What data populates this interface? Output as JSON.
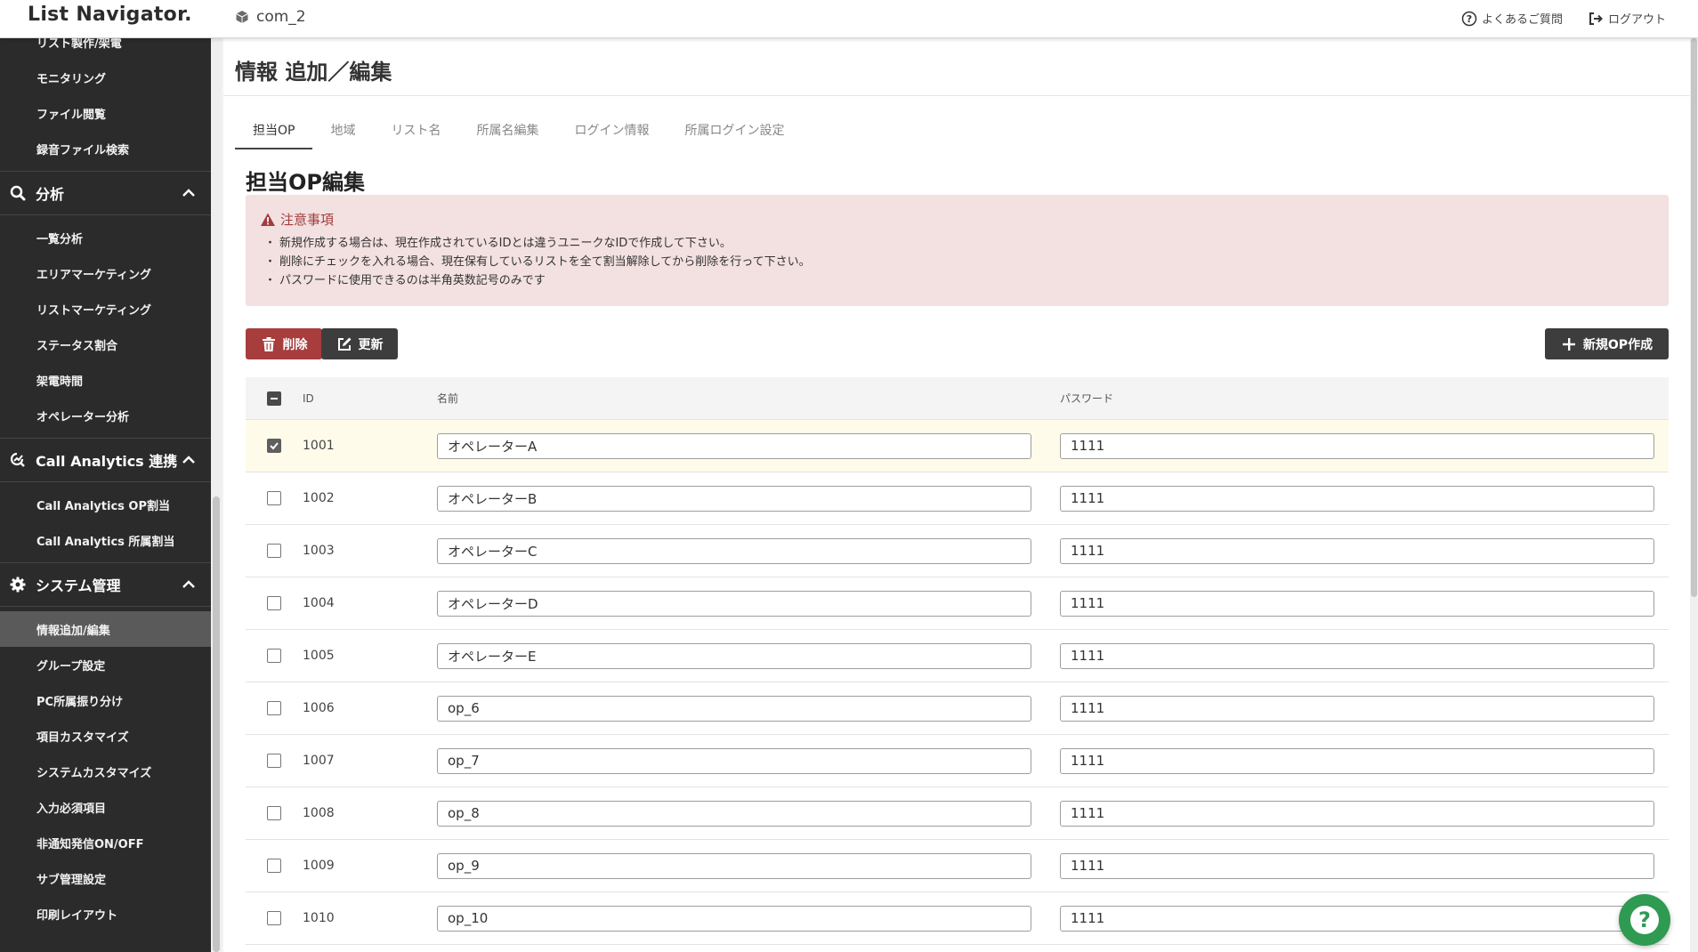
{
  "app": {
    "logo": "List Navigator.",
    "company": "com_2"
  },
  "top_links": {
    "faq": "よくあるご質問",
    "logout": "ログアウト"
  },
  "sidebar": {
    "items_top": [
      {
        "label": "リスト製作/架電",
        "name": "sidebar-item-list-call"
      },
      {
        "label": "モニタリング",
        "name": "sidebar-item-monitoring"
      },
      {
        "label": "ファイル閲覧",
        "name": "sidebar-item-file-view"
      },
      {
        "label": "録音ファイル検索",
        "name": "sidebar-item-recording-search"
      }
    ],
    "section_analysis": {
      "label": "分析",
      "items": [
        {
          "label": "一覧分析",
          "name": "sidebar-item-list-analysis"
        },
        {
          "label": "エリアマーケティング",
          "name": "sidebar-item-area-marketing"
        },
        {
          "label": "リストマーケティング",
          "name": "sidebar-item-list-marketing"
        },
        {
          "label": "ステータス割合",
          "name": "sidebar-item-status-ratio"
        },
        {
          "label": "架電時間",
          "name": "sidebar-item-call-time"
        },
        {
          "label": "オペレーター分析",
          "name": "sidebar-item-operator-analysis"
        }
      ]
    },
    "section_callanalytics": {
      "label": "Call Analytics 連携",
      "items": [
        {
          "label": "Call Analytics OP割当",
          "name": "sidebar-item-ca-op-assign"
        },
        {
          "label": "Call Analytics 所属割当",
          "name": "sidebar-item-ca-dept-assign"
        }
      ]
    },
    "section_system": {
      "label": "システム管理",
      "items": [
        {
          "label": "情報追加/編集",
          "name": "sidebar-item-info-edit",
          "active": true
        },
        {
          "label": "グループ設定",
          "name": "sidebar-item-group-settings"
        },
        {
          "label": "PC所属振り分け",
          "name": "sidebar-item-pc-assign"
        },
        {
          "label": "項目カスタマイズ",
          "name": "sidebar-item-field-customize"
        },
        {
          "label": "システムカスタマイズ",
          "name": "sidebar-item-system-customize"
        },
        {
          "label": "入力必須項目",
          "name": "sidebar-item-required-fields"
        },
        {
          "label": "非通知発信ON/OFF",
          "name": "sidebar-item-hidden-caller"
        },
        {
          "label": "サブ管理設定",
          "name": "sidebar-item-sub-admin"
        },
        {
          "label": "印刷レイアウト",
          "name": "sidebar-item-print-layout"
        }
      ]
    }
  },
  "page": {
    "title": "情報 追加／編集",
    "section_title": "担当OP編集"
  },
  "tabs": [
    "担当OP",
    "地域",
    "リスト名",
    "所属名編集",
    "ログイン情報",
    "所属ログイン設定"
  ],
  "notice": {
    "heading": "注意事項",
    "lines": [
      "新規作成する場合は、現在作成されているIDとは違うユニークなIDで作成して下さい。",
      "削除にチェックを入れる場合、現在保有しているリストを全て割当解除してから削除を行って下さい。",
      "パスワードに使用できるのは半角英数記号のみです"
    ]
  },
  "buttons": {
    "delete": "削除",
    "update": "更新",
    "new_op": "新規OP作成"
  },
  "table": {
    "headers": {
      "id": "ID",
      "name": "名前",
      "password": "パスワード"
    },
    "rows": [
      {
        "id": "1001",
        "name": "オペレーターA",
        "password": "1111",
        "checked": true
      },
      {
        "id": "1002",
        "name": "オペレーターB",
        "password": "1111",
        "checked": false
      },
      {
        "id": "1003",
        "name": "オペレーターC",
        "password": "1111",
        "checked": false
      },
      {
        "id": "1004",
        "name": "オペレーターD",
        "password": "1111",
        "checked": false
      },
      {
        "id": "1005",
        "name": "オペレーターE",
        "password": "1111",
        "checked": false
      },
      {
        "id": "1006",
        "name": "op_6",
        "password": "1111",
        "checked": false
      },
      {
        "id": "1007",
        "name": "op_7",
        "password": "1111",
        "checked": false
      },
      {
        "id": "1008",
        "name": "op_8",
        "password": "1111",
        "checked": false
      },
      {
        "id": "1009",
        "name": "op_9",
        "password": "1111",
        "checked": false
      },
      {
        "id": "1010",
        "name": "op_10",
        "password": "1111",
        "checked": false
      }
    ]
  },
  "colors": {
    "accent_red": "#a73d3d",
    "dark_button": "#3d3d3d",
    "sidebar_bg": "#2b2b2b",
    "notice_bg": "#f3e0e1",
    "help_green": "#2f9a52"
  }
}
